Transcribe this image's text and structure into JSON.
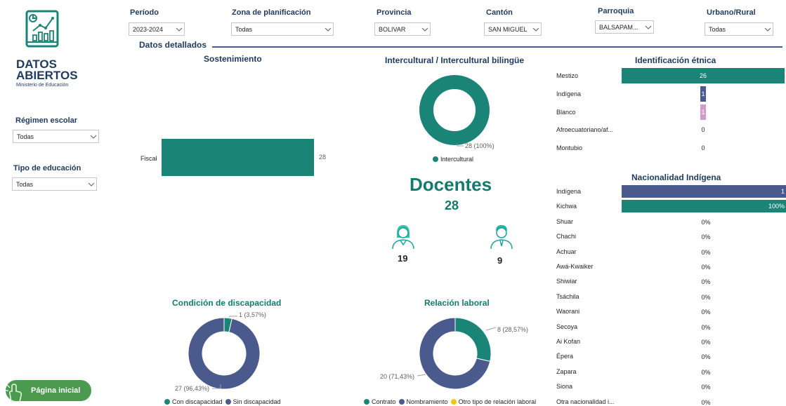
{
  "logo": {
    "line1": "DATOS",
    "line2": "ABIERTOS",
    "subtitle": "Ministerio de Educación"
  },
  "filters": {
    "periodo": {
      "label": "Período",
      "value": "2023-2024"
    },
    "zona": {
      "label": "Zona de planificación",
      "value": "Todas"
    },
    "provincia": {
      "label": "Provincia",
      "value": "BOLIVAR"
    },
    "canton": {
      "label": "Cantón",
      "value": "SAN MIGUEL"
    },
    "parroquia": {
      "label": "Parroquia",
      "value": "BALSAPAM..."
    },
    "urbano": {
      "label": "Urbano/Rural",
      "value": "Todas"
    },
    "regimen": {
      "label": "Régimen escolar",
      "value": "Todas"
    },
    "tipo": {
      "label": "Tipo de educación",
      "value": "Todas"
    }
  },
  "section_title": "Datos detallados",
  "home_button": {
    "label": "Página inicial",
    "icon": "hand-pointer-icon"
  },
  "docentes": {
    "title": "Docentes",
    "total": "28",
    "female": "19",
    "male": "9",
    "female_icon": "female-teacher-icon",
    "male_icon": "male-teacher-icon"
  },
  "colors": {
    "teal": "#1a8577",
    "navy": "#4a5a8c",
    "pink": "#d19ccc",
    "yellow": "#f2c80f",
    "title_teal": "#147a6d",
    "title_navy": "#1e3a5f"
  },
  "charts": {
    "sostenimiento": {
      "title": "Sostenimiento",
      "chart_data": {
        "type": "bar",
        "categories": [
          "Fiscal"
        ],
        "values": [
          28
        ],
        "value_labels": [
          "28"
        ],
        "xlim": [
          0,
          28
        ]
      }
    },
    "intercultural": {
      "title": "Intercultural / Intercultural bilingüe",
      "chart_data": {
        "type": "pie",
        "series": [
          {
            "name": "Intercultural",
            "value": 28,
            "label": "28 (100%)"
          }
        ],
        "legend": [
          "Intercultural"
        ]
      }
    },
    "identificacion": {
      "title": "Identificación étnica",
      "chart_data": {
        "type": "bar",
        "categories": [
          "Mestizo",
          "Indígena",
          "Blanco",
          "Afroecuatoriano/af...",
          "Montubio"
        ],
        "values": [
          26,
          1,
          1,
          0,
          0
        ],
        "value_labels": [
          "26",
          "1",
          "1",
          "0",
          "0"
        ],
        "xlim": [
          0,
          26
        ]
      }
    },
    "nacionalidad": {
      "title": "Nacionalidad Indígena",
      "chart_data": {
        "type": "bar",
        "categories": [
          "Indígena",
          "Kichwa",
          "Shuar",
          "Chachi",
          "Achuar",
          "Awá-Kwaiker",
          "Shiwiar",
          "Tsáchila",
          "Waorani",
          "Secoya",
          "Ai Kofan",
          "Épera",
          "Zapara",
          "Siona",
          "Otra nacionalidad i..."
        ],
        "values": [
          1,
          1,
          0,
          0,
          0,
          0,
          0,
          0,
          0,
          0,
          0,
          0,
          0,
          0,
          0
        ],
        "value_labels": [
          "1",
          "100%",
          "0%",
          "0%",
          "0%",
          "0%",
          "0%",
          "0%",
          "0%",
          "0%",
          "0%",
          "0%",
          "0%",
          "0%",
          "0%"
        ]
      }
    },
    "discapacidad": {
      "title": "Condición de discapacidad",
      "chart_data": {
        "type": "pie",
        "series": [
          {
            "name": "Con discapacidad",
            "value": 1,
            "label": "1 (3,57%)"
          },
          {
            "name": "Sin discapacidad",
            "value": 27,
            "label": "27 (96,43%)"
          }
        ],
        "legend": [
          "Con discapacidad",
          "Sin discapacidad"
        ]
      }
    },
    "relacion": {
      "title": "Relación laboral",
      "chart_data": {
        "type": "pie",
        "series": [
          {
            "name": "Contrato",
            "value": 8,
            "label": "8 (28,57%)"
          },
          {
            "name": "Nombramiento",
            "value": 20,
            "label": "20 (71,43%)"
          },
          {
            "name": "Otro tipo de relación laboral",
            "value": 0,
            "label": ""
          }
        ],
        "legend": [
          "Contrato",
          "Nombramiento",
          "Otro tipo de relación laboral"
        ]
      }
    }
  }
}
